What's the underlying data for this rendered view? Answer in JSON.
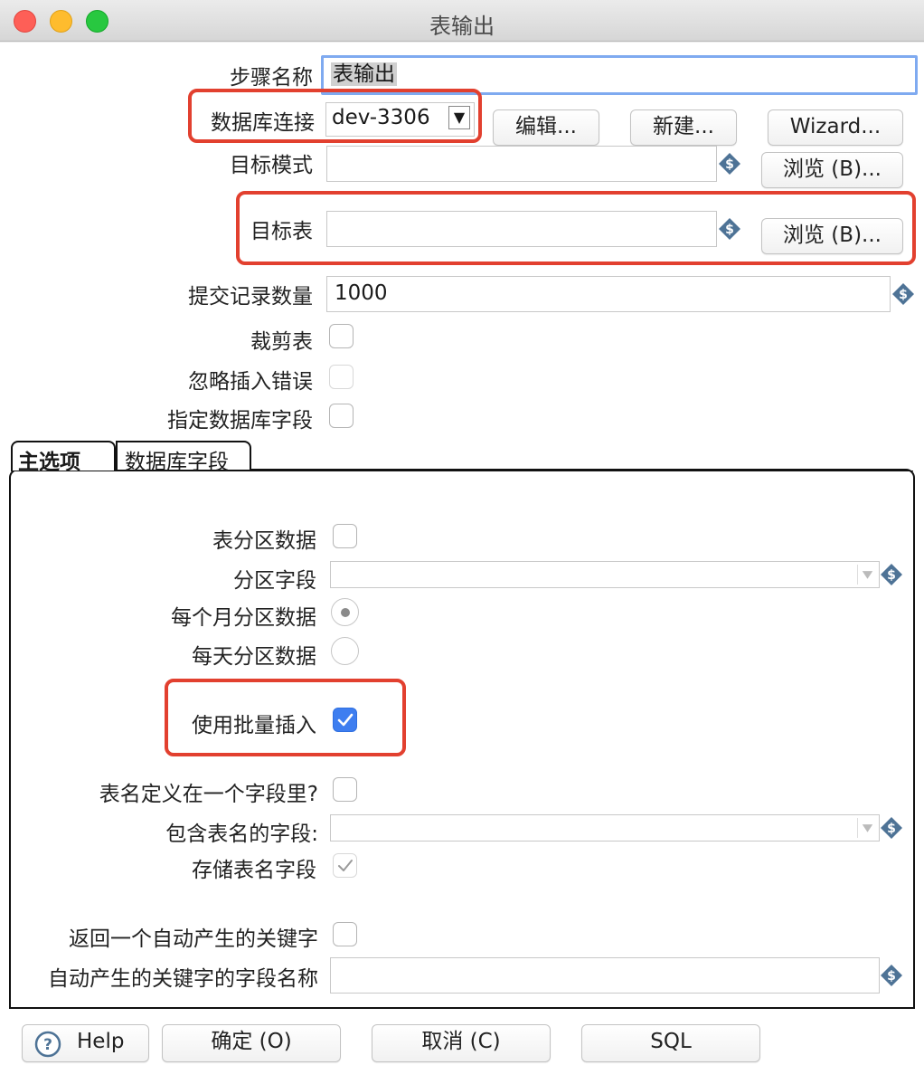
{
  "window": {
    "title": "表输出"
  },
  "form": {
    "step_name": {
      "label": "步骤名称",
      "value": "表输出"
    },
    "db_connection": {
      "label": "数据库连接",
      "value": "dev-3306",
      "dropdown_glyph": "▼"
    },
    "buttons": {
      "edit": "编辑...",
      "new": "新建...",
      "wizard": "Wizard..."
    },
    "target_schema": {
      "label": "目标模式",
      "value": "",
      "browse": "浏览 (B)..."
    },
    "target_table": {
      "label": "目标表",
      "value": "",
      "browse": "浏览 (B)..."
    },
    "commit_size": {
      "label": "提交记录数量",
      "value": "1000"
    },
    "truncate_table": {
      "label": "裁剪表",
      "checked": false
    },
    "ignore_insert_errors": {
      "label": "忽略插入错误",
      "checked": false
    },
    "specify_db_fields": {
      "label": "指定数据库字段",
      "checked": false
    }
  },
  "tabs": [
    {
      "label": "主选项",
      "active": true
    },
    {
      "label": "数据库字段",
      "active": false
    }
  ],
  "main_tab": {
    "partition_data": {
      "label": "表分区数据",
      "checked": false
    },
    "partition_field": {
      "label": "分区字段",
      "value": ""
    },
    "monthly_partition": {
      "label": "每个月分区数据",
      "selected": true
    },
    "daily_partition": {
      "label": "每天分区数据",
      "selected": false
    },
    "use_batch_insert": {
      "label": "使用批量插入",
      "checked": true
    },
    "tablename_in_field": {
      "label": "表名定义在一个字段里?",
      "checked": false
    },
    "tablename_field": {
      "label": "包含表名的字段:",
      "value": ""
    },
    "store_tablename_field": {
      "label": "存储表名字段",
      "checked": true,
      "disabled": true
    },
    "return_generated_key": {
      "label": "返回一个自动产生的关键字",
      "checked": false
    },
    "generated_key_field": {
      "label": "自动产生的关键字的字段名称",
      "value": ""
    }
  },
  "footer": {
    "help": "Help",
    "help_icon": "question-circle-icon",
    "ok": "确定 (O)",
    "cancel": "取消 (C)",
    "sql": "SQL"
  },
  "colors": {
    "accent": "#3e7ef0",
    "highlight": "#e2402f",
    "focus": "#7faaf0"
  }
}
